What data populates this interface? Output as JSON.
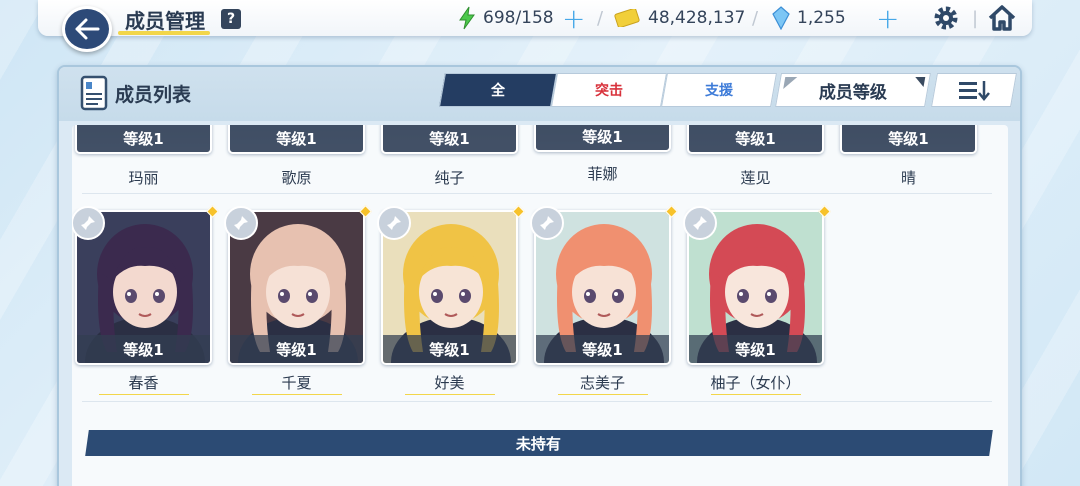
{
  "header": {
    "title": "成员管理",
    "help": "?",
    "ap": "698/158",
    "credits": "48,428,137",
    "gems": "1,255"
  },
  "panel": {
    "title": "成员列表",
    "tabs": [
      "全",
      "突击",
      "支援"
    ],
    "sort_label": "成员等级",
    "unowned_label": "未持有"
  },
  "students_top": [
    {
      "name": "玛丽",
      "level": "等级1"
    },
    {
      "name": "歌原",
      "level": "等级1"
    },
    {
      "name": "纯子",
      "level": "等级1"
    },
    {
      "name": "菲娜",
      "level": "等级1"
    },
    {
      "name": "莲见",
      "level": "等级1"
    },
    {
      "name": "晴",
      "level": "等级1"
    }
  ],
  "students": [
    {
      "name": "春香",
      "level": "等级1",
      "hair": "#3b2a4e",
      "bg": "#3a3f5c",
      "skin": "#f3d9cf"
    },
    {
      "name": "千夏",
      "level": "等级1",
      "hair": "#e7c1b0",
      "bg": "#4a3a44",
      "skin": "#f6e1d6"
    },
    {
      "name": "好美",
      "level": "等级1",
      "hair": "#f0c345",
      "bg": "#eadfbc",
      "skin": "#f7e4d6"
    },
    {
      "name": "志美子",
      "level": "等级1",
      "hair": "#f09070",
      "bg": "#cfe2e0",
      "skin": "#f7e2d6"
    },
    {
      "name": "柚子（女仆）",
      "level": "等级1",
      "hair": "#d44a55",
      "bg": "#bfe0d0",
      "skin": "#f8e6dc"
    }
  ]
}
